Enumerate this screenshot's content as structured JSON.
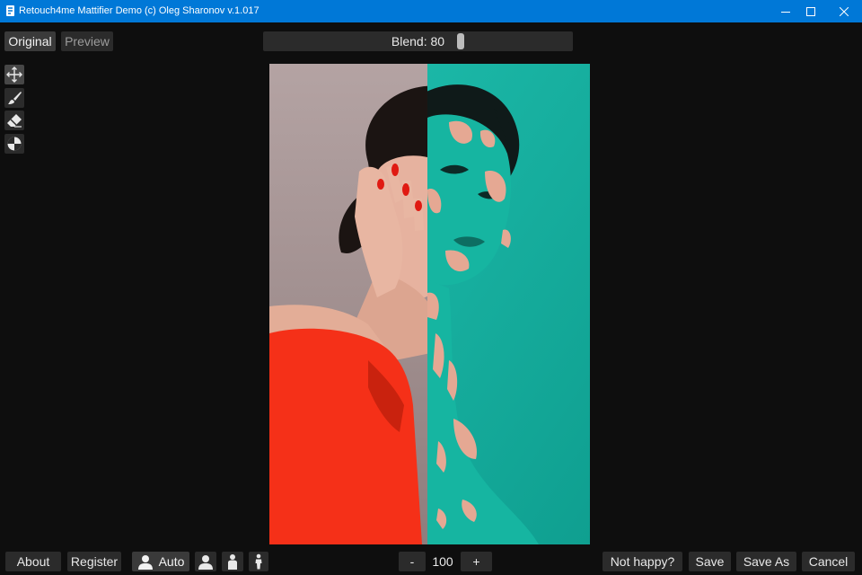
{
  "window": {
    "title": "Retouch4me Mattifier Demo (c) Oleg Sharonov v.1.017",
    "controls": [
      "minimize-icon",
      "maximize-icon",
      "close-icon"
    ],
    "titlebar_color": "#0078d7"
  },
  "view_toggle": {
    "original_label": "Original",
    "preview_label": "Preview",
    "selected": "Original"
  },
  "blend": {
    "label": "Blend: 80",
    "value": 80,
    "max": 100
  },
  "tools": [
    {
      "name": "move-icon",
      "active": true
    },
    {
      "name": "brush-icon",
      "active": false
    },
    {
      "name": "eraser-icon",
      "active": false
    },
    {
      "name": "mask-icon",
      "active": false
    }
  ],
  "bottom_bar": {
    "about_label": "About",
    "register_label": "Register",
    "auto_label": "Auto",
    "portrait_mode_icons": [
      "portrait-head-icon",
      "portrait-half-icon",
      "portrait-full-icon"
    ],
    "zoom": {
      "minus_label": "-",
      "value": "100",
      "plus_label": "+"
    },
    "not_happy_label": "Not happy?",
    "save_label": "Save",
    "save_as_label": "Save As",
    "cancel_label": "Cancel"
  },
  "colors": {
    "background": "#0e0e0e",
    "button": "#2b2b2b",
    "mask_overlay": "#16b5a1",
    "dress": "#f53018"
  }
}
